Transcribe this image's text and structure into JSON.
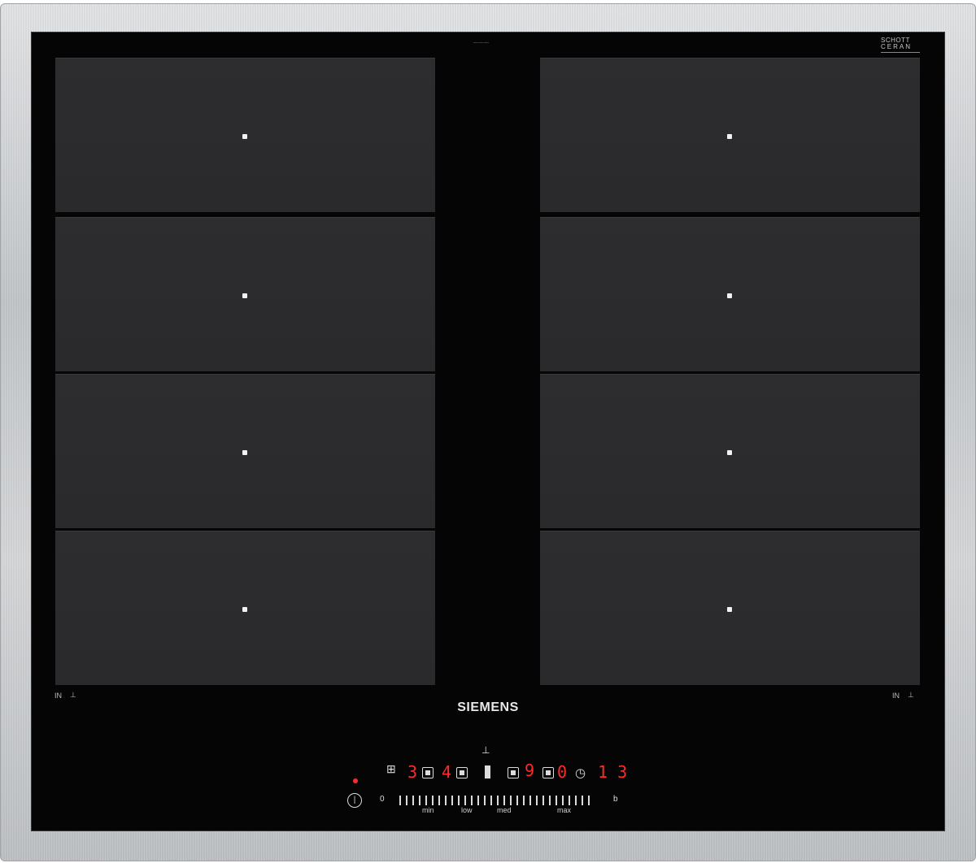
{
  "brand": "SIEMENS",
  "glass_brand": {
    "line1": "SCHOTT",
    "line2": "CERAN"
  },
  "corner_labels": {
    "left": "IN",
    "right": "IN"
  },
  "controls": {
    "display_left": "3",
    "display_mid": "4",
    "display_right": "0",
    "display_timer": "1 3",
    "display_center": "9",
    "slider_min": "min",
    "slider_low": "low",
    "slider_med": "med",
    "slider_max": "max",
    "left_end": "0",
    "right_end": "b"
  },
  "colors": {
    "glass": "#050505",
    "zone": "#2d2d2f",
    "frame": "#c9ccce",
    "display_red": "#ff2a2a"
  },
  "icons": [
    "power-icon",
    "timer-icon",
    "pan-icon"
  ]
}
